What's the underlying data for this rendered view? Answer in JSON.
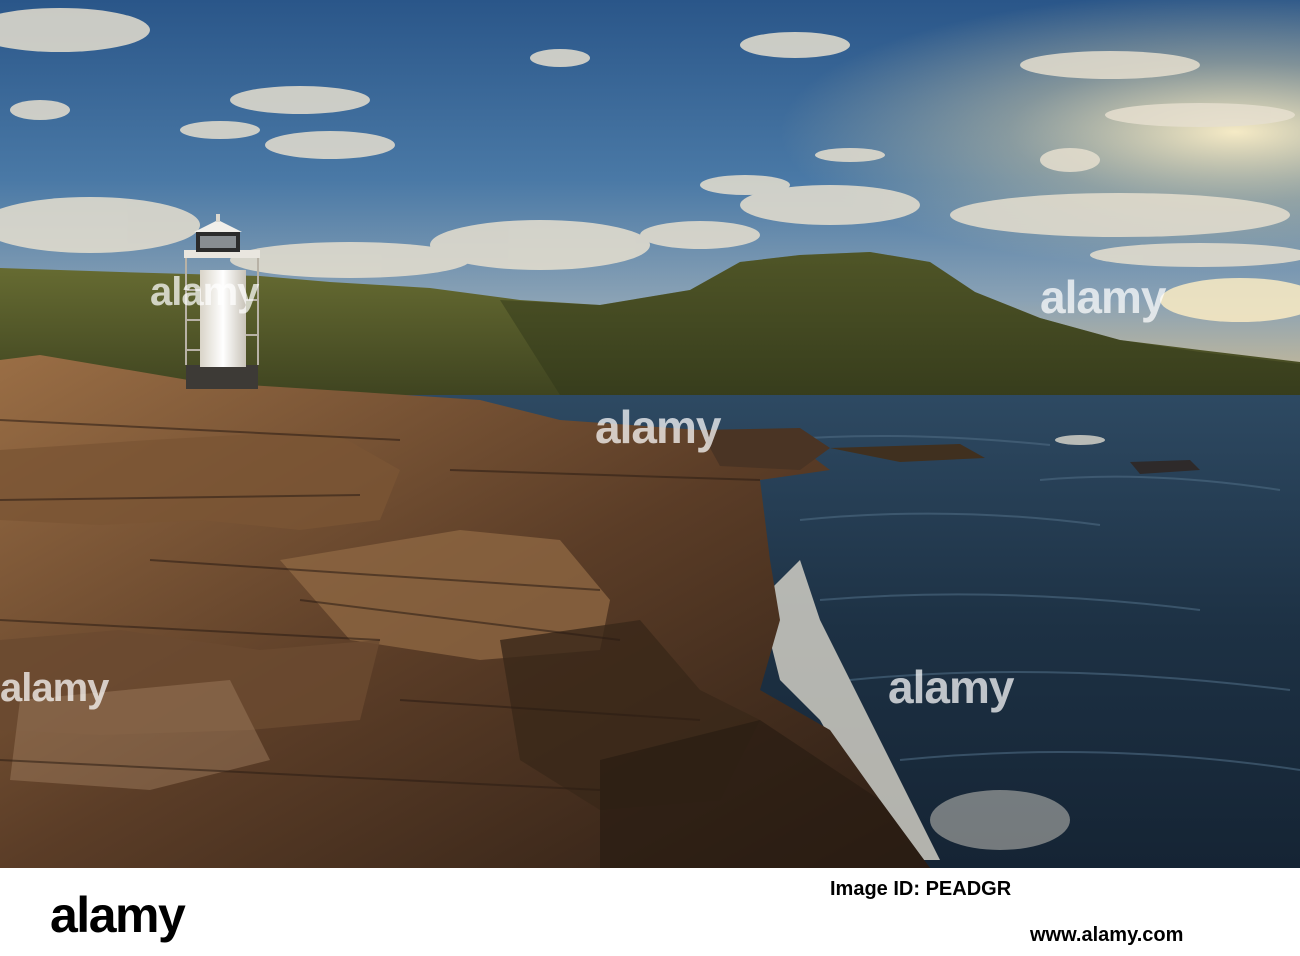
{
  "photo": {
    "subject": "White lighthouse on rocky shore with waves and mountains at sunset",
    "colors": {
      "sky_top": "#2e5a8c",
      "sky_mid": "#5d84a8",
      "sky_horizon": "#c9b48a",
      "sea": "#1f3346",
      "hills": "#4e5a2a",
      "rock": "#5a3f2a",
      "rock_light": "#a07a52"
    },
    "watermark_text": "alamy"
  },
  "footer": {
    "logo": "alamy",
    "image_id": "Image ID: PEADGR",
    "url": "www.alamy.com"
  }
}
